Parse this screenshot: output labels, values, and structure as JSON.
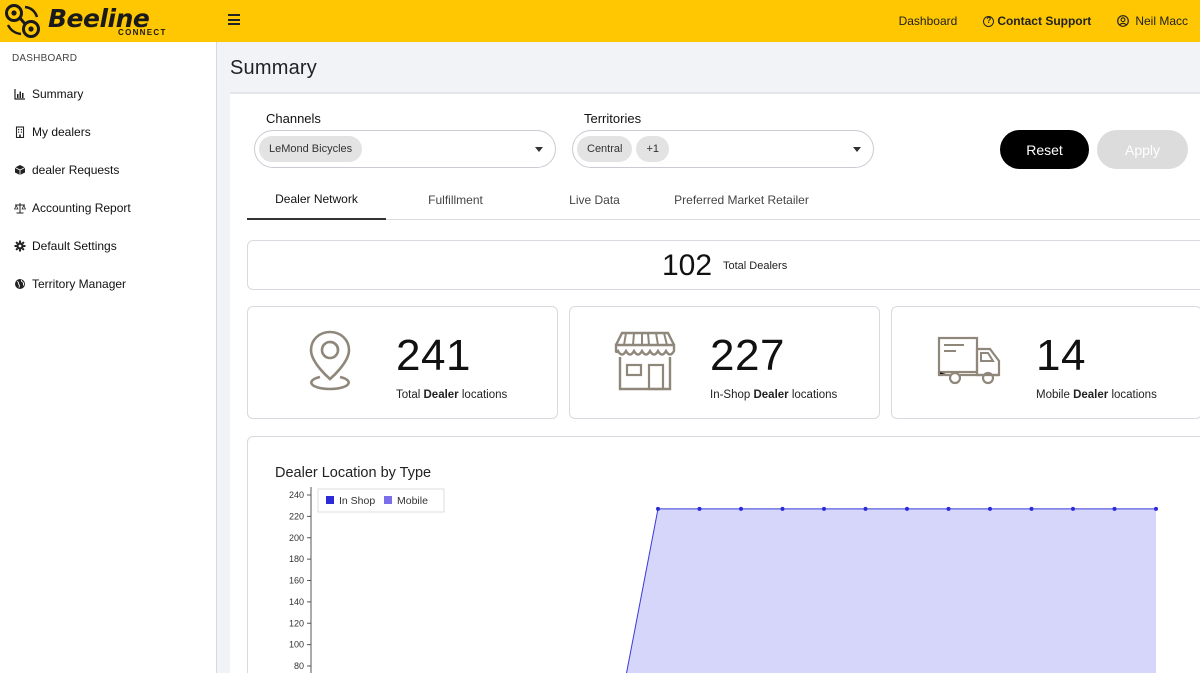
{
  "brand": {
    "name": "Beeline",
    "sub": "CONNECT"
  },
  "topnav": {
    "dashboard": "Dashboard",
    "support": "Contact Support",
    "user": "Neil Macc"
  },
  "sidebar": {
    "heading": "DASHBOARD",
    "items": [
      {
        "label": "Summary",
        "icon": "bar-chart-icon"
      },
      {
        "label": "My dealers",
        "icon": "building-icon"
      },
      {
        "label": "dealer Requests",
        "icon": "box-icon"
      },
      {
        "label": "Accounting Report",
        "icon": "scale-icon"
      },
      {
        "label": "Default Settings",
        "icon": "gear-icon"
      },
      {
        "label": "Territory Manager",
        "icon": "globe-icon"
      }
    ]
  },
  "page_title": "Summary",
  "filters": {
    "channels_label": "Channels",
    "channels_chips": [
      "LeMond Bicycles"
    ],
    "territories_label": "Territories",
    "territories_chips": [
      "Central",
      "+1"
    ]
  },
  "buttons": {
    "reset": "Reset",
    "apply": "Apply"
  },
  "tabs": [
    "Dealer Network",
    "Fulfillment",
    "Live Data",
    "Preferred Market Retailer"
  ],
  "summary": {
    "total_dealers": "102",
    "total_dealers_label": "Total Dealers",
    "cards": [
      {
        "value": "241",
        "prefix": "Total ",
        "bold": "Dealer",
        "suffix": " locations",
        "icon": "map-pin-icon"
      },
      {
        "value": "227",
        "prefix": "In-Shop ",
        "bold": "Dealer",
        "suffix": " locations",
        "icon": "storefront-icon"
      },
      {
        "value": "14",
        "prefix": "Mobile ",
        "bold": "Dealer",
        "suffix": " locations",
        "icon": "truck-icon"
      }
    ]
  },
  "colors": {
    "brand_yellow": "#fec701",
    "in_shop": "#2b2bd9",
    "mobile": "#7b6ee8",
    "area_fill": "#d6d6fb"
  },
  "chart_data": {
    "type": "area",
    "title": "Dealer Location by Type",
    "legend": [
      "In Shop",
      "Mobile"
    ],
    "legend_position": "top-left",
    "y_ticks": [
      80,
      100,
      120,
      140,
      160,
      180,
      200,
      220,
      240
    ],
    "ylim": [
      80,
      245
    ],
    "series": [
      {
        "name": "In Shop",
        "values": [
          0,
          0,
          0,
          0,
          0,
          0,
          0,
          0,
          0,
          0,
          0,
          0,
          0,
          0,
          0,
          0,
          0,
          0,
          0,
          0
        ]
      },
      {
        "name": "Mobile",
        "values": [
          0,
          0,
          0,
          0,
          0,
          0,
          0,
          0,
          0,
          227,
          227,
          227,
          227,
          227,
          227,
          227,
          227,
          227,
          227,
          227,
          227,
          227
        ]
      }
    ]
  }
}
